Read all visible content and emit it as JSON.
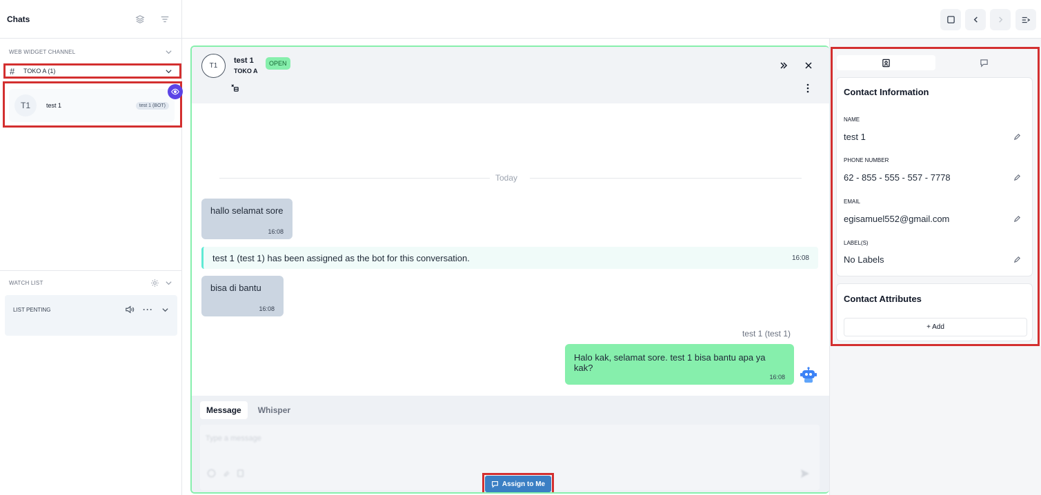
{
  "sidebar": {
    "title": "Chats",
    "inbox_section_label": "WEB WIDGET CHANNEL",
    "channel": {
      "hash": "#",
      "name": "TOKO A (1)"
    },
    "conversation": {
      "avatar": "T1",
      "name": "test 1",
      "badge": "test 1 (BOT)"
    },
    "watchlist": {
      "label": "WATCH LIST",
      "list_name": "LIST PENTING",
      "more": "···"
    }
  },
  "conversation": {
    "avatar": "T1",
    "contact_name": "test 1",
    "inbox_name": "TOKO A",
    "status": "OPEN",
    "date_divider": "Today",
    "messages": [
      {
        "text": "hallo selamat sore",
        "time": "16:08"
      },
      {
        "text": "bisa di bantu",
        "time": "16:08"
      }
    ],
    "activity": {
      "text": "test 1 (test 1) has been assigned as the bot for this conversation.",
      "time": "16:08"
    },
    "outgoing": {
      "sender": "test 1 (test 1)",
      "text": "Halo kak, selamat sore. test 1 bisa bantu apa ya kak?",
      "time": "16:08"
    },
    "reply": {
      "tabs": [
        "Message",
        "Whisper"
      ],
      "placeholder": "Type a message",
      "assign_label": "Assign to Me"
    }
  },
  "contact_panel": {
    "info_title": "Contact Information",
    "fields": [
      {
        "label": "NAME",
        "value": "test 1"
      },
      {
        "label": "PHONE NUMBER",
        "value": "62 - 855 - 555 - 557 - 7778"
      },
      {
        "label": "EMAIL",
        "value": "egisamuel552@gmail.com"
      },
      {
        "label": "LABEL(S)",
        "value": "No Labels"
      }
    ],
    "attributes_title": "Contact Attributes",
    "add_label": "+ Add"
  },
  "colors": {
    "open_badge": "#86efac",
    "outgoing_bubble": "#86efac",
    "assign_button": "#3b7fc4",
    "highlight": "#d32f2f",
    "bot_eye": "#5b44e6"
  }
}
